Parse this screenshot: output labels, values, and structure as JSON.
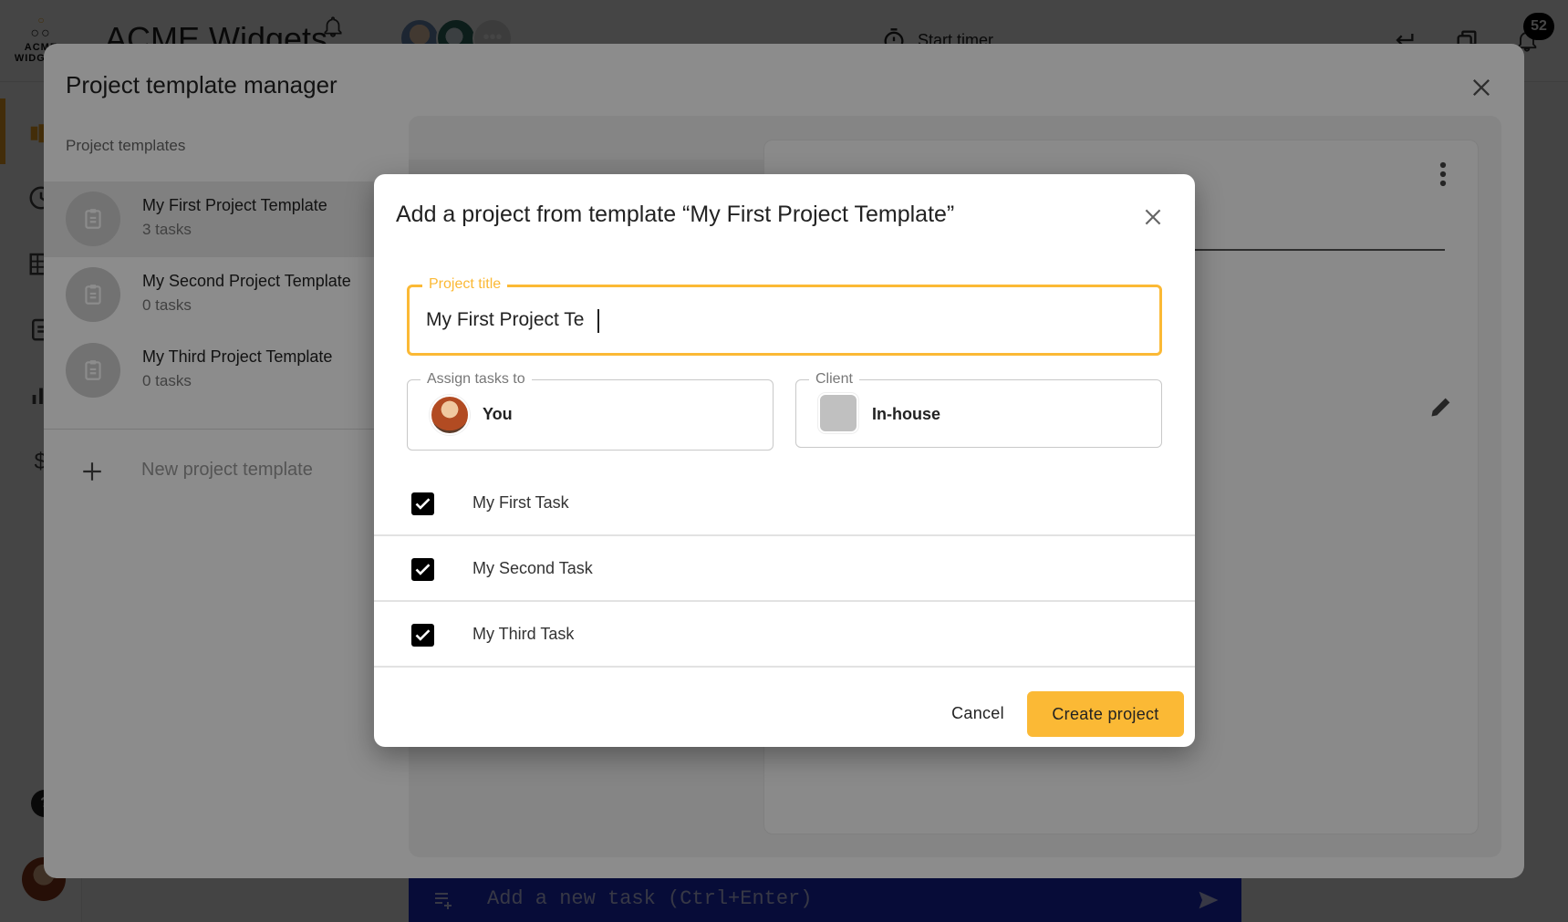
{
  "app": {
    "logo_text_1": "ACME",
    "logo_text_2": "WIDGETS",
    "title": "ACME Widgets",
    "timer_label": "Start timer",
    "notification_count": "52",
    "more_avatars": "•••",
    "task_bar_placeholder": "Add a new task (Ctrl+Enter)",
    "help_label": "?",
    "accent_color": "#f5a623"
  },
  "manager": {
    "title": "Project template manager",
    "list_heading": "Project templates",
    "templates": [
      {
        "name": "My First Project Template",
        "count": "3 tasks",
        "selected": true
      },
      {
        "name": "My Second Project Template",
        "count": "0 tasks",
        "selected": false
      },
      {
        "name": "My Third Project Template",
        "count": "0 tasks",
        "selected": false
      }
    ],
    "new_template_label": "New project template"
  },
  "dialog": {
    "title": "Add a project from template “My First Project Template”",
    "project_title": {
      "label": "Project title",
      "value": "My First Project Te"
    },
    "assign": {
      "label": "Assign tasks to",
      "value": "You"
    },
    "client": {
      "label": "Client",
      "value": "In-house"
    },
    "tasks": [
      {
        "label": "My First Task",
        "checked": true
      },
      {
        "label": "My Second Task",
        "checked": true
      },
      {
        "label": "My Third Task",
        "checked": true
      }
    ],
    "cancel_label": "Cancel",
    "create_label": "Create project",
    "primary_color": "#fbb935"
  }
}
